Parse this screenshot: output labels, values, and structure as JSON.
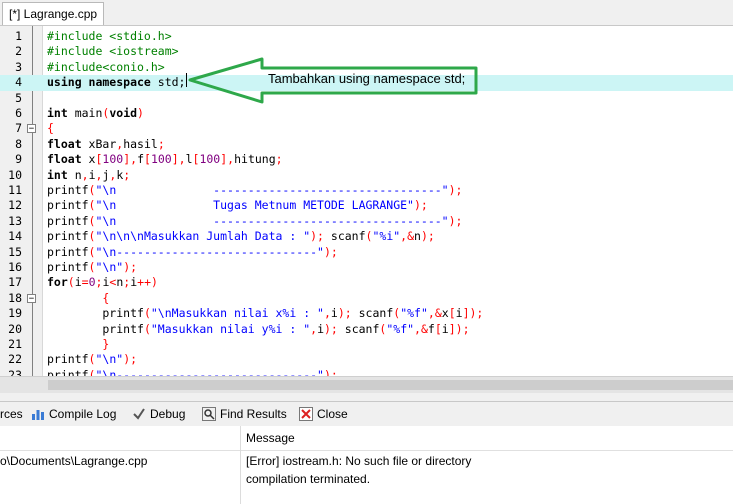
{
  "editor": {
    "tab_title": "[*] Lagrange.cpp",
    "annotation_text": "Tambahkan using namespace std;",
    "lines": [
      {
        "n": "1",
        "segs": [
          {
            "t": "#include <stdio.h>",
            "c": "pp"
          }
        ]
      },
      {
        "n": "2",
        "segs": [
          {
            "t": "#include <iostream>",
            "c": "pp"
          }
        ]
      },
      {
        "n": "3",
        "segs": [
          {
            "t": "#include<conio.h>",
            "c": "pp"
          }
        ]
      },
      {
        "n": "4",
        "hl": true,
        "segs": [
          {
            "t": "using namespace ",
            "c": "kw"
          },
          {
            "t": "std;",
            "c": ""
          }
        ]
      },
      {
        "n": "5",
        "segs": []
      },
      {
        "n": "6",
        "segs": [
          {
            "t": "int ",
            "c": "kw"
          },
          {
            "t": "main",
            "c": ""
          },
          {
            "t": "(",
            "c": "br"
          },
          {
            "t": "void",
            "c": "kw"
          },
          {
            "t": ")",
            "c": "br"
          }
        ]
      },
      {
        "n": "7",
        "fold": "−",
        "segs": [
          {
            "t": "{",
            "c": "br"
          }
        ]
      },
      {
        "n": "8",
        "segs": [
          {
            "t": "float ",
            "c": "kw"
          },
          {
            "t": "xBar",
            "c": ""
          },
          {
            "t": ",",
            "c": "br"
          },
          {
            "t": "hasil",
            "c": ""
          },
          {
            "t": ";",
            "c": "br"
          }
        ]
      },
      {
        "n": "9",
        "segs": [
          {
            "t": "float ",
            "c": "kw"
          },
          {
            "t": "x",
            "c": ""
          },
          {
            "t": "[",
            "c": "br"
          },
          {
            "t": "100",
            "c": "num"
          },
          {
            "t": "],",
            "c": "br"
          },
          {
            "t": "f",
            "c": ""
          },
          {
            "t": "[",
            "c": "br"
          },
          {
            "t": "100",
            "c": "num"
          },
          {
            "t": "],",
            "c": "br"
          },
          {
            "t": "l",
            "c": ""
          },
          {
            "t": "[",
            "c": "br"
          },
          {
            "t": "100",
            "c": "num"
          },
          {
            "t": "],",
            "c": "br"
          },
          {
            "t": "hitung",
            "c": ""
          },
          {
            "t": ";",
            "c": "br"
          }
        ]
      },
      {
        "n": "10",
        "segs": [
          {
            "t": "int ",
            "c": "kw"
          },
          {
            "t": "n",
            "c": ""
          },
          {
            "t": ",",
            "c": "br"
          },
          {
            "t": "i",
            "c": ""
          },
          {
            "t": ",",
            "c": "br"
          },
          {
            "t": "j",
            "c": ""
          },
          {
            "t": ",",
            "c": "br"
          },
          {
            "t": "k",
            "c": ""
          },
          {
            "t": ";",
            "c": "br"
          }
        ]
      },
      {
        "n": "11",
        "segs": [
          {
            "t": "printf",
            "c": ""
          },
          {
            "t": "(",
            "c": "br"
          },
          {
            "t": "\"\\n              ---------------------------------\"",
            "c": "str"
          },
          {
            "t": ");",
            "c": "br"
          }
        ]
      },
      {
        "n": "12",
        "segs": [
          {
            "t": "printf",
            "c": ""
          },
          {
            "t": "(",
            "c": "br"
          },
          {
            "t": "\"\\n              Tugas Metnum METODE LAGRANGE\"",
            "c": "str"
          },
          {
            "t": ");",
            "c": "br"
          }
        ]
      },
      {
        "n": "13",
        "segs": [
          {
            "t": "printf",
            "c": ""
          },
          {
            "t": "(",
            "c": "br"
          },
          {
            "t": "\"\\n              ---------------------------------\"",
            "c": "str"
          },
          {
            "t": ");",
            "c": "br"
          }
        ]
      },
      {
        "n": "14",
        "segs": [
          {
            "t": "printf",
            "c": ""
          },
          {
            "t": "(",
            "c": "br"
          },
          {
            "t": "\"\\n\\n\\nMasukkan Jumlah Data : \"",
            "c": "str"
          },
          {
            "t": "); ",
            "c": "br"
          },
          {
            "t": "scanf",
            "c": ""
          },
          {
            "t": "(",
            "c": "br"
          },
          {
            "t": "\"%i\"",
            "c": "str"
          },
          {
            "t": ",&",
            "c": "br"
          },
          {
            "t": "n",
            "c": ""
          },
          {
            "t": ");",
            "c": "br"
          }
        ]
      },
      {
        "n": "15",
        "segs": [
          {
            "t": "printf",
            "c": ""
          },
          {
            "t": "(",
            "c": "br"
          },
          {
            "t": "\"\\n-----------------------------\"",
            "c": "str"
          },
          {
            "t": ");",
            "c": "br"
          }
        ]
      },
      {
        "n": "16",
        "segs": [
          {
            "t": "printf",
            "c": ""
          },
          {
            "t": "(",
            "c": "br"
          },
          {
            "t": "\"\\n\"",
            "c": "str"
          },
          {
            "t": ");",
            "c": "br"
          }
        ]
      },
      {
        "n": "17",
        "segs": [
          {
            "t": "for",
            "c": "kw"
          },
          {
            "t": "(",
            "c": "br"
          },
          {
            "t": "i",
            "c": ""
          },
          {
            "t": "=",
            "c": "br"
          },
          {
            "t": "0",
            "c": "num"
          },
          {
            "t": ";",
            "c": "br"
          },
          {
            "t": "i",
            "c": ""
          },
          {
            "t": "<",
            "c": "br"
          },
          {
            "t": "n",
            "c": ""
          },
          {
            "t": ";",
            "c": "br"
          },
          {
            "t": "i",
            "c": ""
          },
          {
            "t": "++)",
            "c": "br"
          }
        ]
      },
      {
        "n": "18",
        "fold": "−",
        "segs": [
          {
            "t": "        {",
            "c": "br"
          }
        ]
      },
      {
        "n": "19",
        "segs": [
          {
            "t": "        printf",
            "c": ""
          },
          {
            "t": "(",
            "c": "br"
          },
          {
            "t": "\"\\nMasukkan nilai x%i : \"",
            "c": "str"
          },
          {
            "t": ",",
            "c": "br"
          },
          {
            "t": "i",
            "c": ""
          },
          {
            "t": "); ",
            "c": "br"
          },
          {
            "t": "scanf",
            "c": ""
          },
          {
            "t": "(",
            "c": "br"
          },
          {
            "t": "\"%f\"",
            "c": "str"
          },
          {
            "t": ",&",
            "c": "br"
          },
          {
            "t": "x",
            "c": ""
          },
          {
            "t": "[",
            "c": "br"
          },
          {
            "t": "i",
            "c": ""
          },
          {
            "t": "]);",
            "c": "br"
          }
        ]
      },
      {
        "n": "20",
        "segs": [
          {
            "t": "        printf",
            "c": ""
          },
          {
            "t": "(",
            "c": "br"
          },
          {
            "t": "\"Masukkan nilai y%i : \"",
            "c": "str"
          },
          {
            "t": ",",
            "c": "br"
          },
          {
            "t": "i",
            "c": ""
          },
          {
            "t": "); ",
            "c": "br"
          },
          {
            "t": "scanf",
            "c": ""
          },
          {
            "t": "(",
            "c": "br"
          },
          {
            "t": "\"%f\"",
            "c": "str"
          },
          {
            "t": ",&",
            "c": "br"
          },
          {
            "t": "f",
            "c": ""
          },
          {
            "t": "[",
            "c": "br"
          },
          {
            "t": "i",
            "c": ""
          },
          {
            "t": "]);",
            "c": "br"
          }
        ]
      },
      {
        "n": "21",
        "segs": [
          {
            "t": "        }",
            "c": "br"
          }
        ]
      },
      {
        "n": "22",
        "segs": [
          {
            "t": "printf",
            "c": ""
          },
          {
            "t": "(",
            "c": "br"
          },
          {
            "t": "\"\\n\"",
            "c": "str"
          },
          {
            "t": ");",
            "c": "br"
          }
        ]
      },
      {
        "n": "23",
        "segs": [
          {
            "t": "printf",
            "c": ""
          },
          {
            "t": "(",
            "c": "br"
          },
          {
            "t": "\"\\n-----------------------------\"",
            "c": "str"
          },
          {
            "t": ");",
            "c": "br"
          }
        ]
      }
    ]
  },
  "bottom_tabs": {
    "resources_partial": "rces",
    "compile_log": "Compile Log",
    "debug": "Debug",
    "find_results": "Find Results",
    "close": "Close"
  },
  "messages": {
    "header_message": "Message",
    "rows": [
      {
        "file": "o\\Documents\\Lagrange.cpp",
        "message": "[Error] iostream.h: No such file or directory"
      },
      {
        "file": "",
        "message": "compilation terminated."
      }
    ]
  },
  "colors": {
    "preprocessor": "#008000",
    "string": "#0000ff",
    "bracket": "#ff0000",
    "number": "#800080",
    "current_line": "#ccf5f5",
    "annotation_arrow": "#2ea84a"
  }
}
